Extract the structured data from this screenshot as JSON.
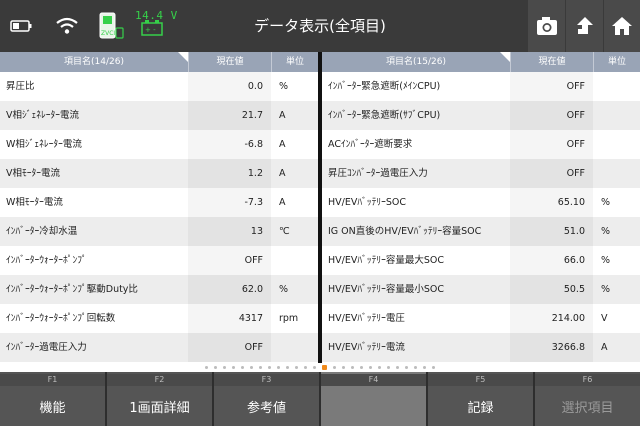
{
  "header": {
    "title": "データ表示(全項目)",
    "voltage": "14.4 V",
    "icons": [
      "battery-icon",
      "wifi-icon",
      "vci-icon",
      "car-battery-icon",
      "camera-icon",
      "upload-icon",
      "home-icon"
    ],
    "vci_label": "ZVCI"
  },
  "left_table": {
    "headers": {
      "name": "項目名(14/26)",
      "value": "現在値",
      "unit": "単位"
    },
    "rows": [
      {
        "name": "昇圧比",
        "value": "0.0",
        "unit": "%"
      },
      {
        "name": "V相ｼﾞｪﾈﾚｰﾀｰ電流",
        "value": "21.7",
        "unit": "A"
      },
      {
        "name": "W相ｼﾞｪﾈﾚｰﾀｰ電流",
        "value": "-6.8",
        "unit": "A"
      },
      {
        "name": "V相ﾓｰﾀｰ電流",
        "value": "1.2",
        "unit": "A"
      },
      {
        "name": "W相ﾓｰﾀｰ電流",
        "value": "-7.3",
        "unit": "A"
      },
      {
        "name": "ｲﾝﾊﾞｰﾀｰ冷却水温",
        "value": "13",
        "unit": "℃"
      },
      {
        "name": "ｲﾝﾊﾞｰﾀｰｳｫｰﾀｰﾎﾟﾝﾌﾟ",
        "value": "OFF",
        "unit": ""
      },
      {
        "name": "ｲﾝﾊﾞｰﾀｰｳｫｰﾀｰﾎﾟﾝﾌﾟ駆動Duty比",
        "value": "62.0",
        "unit": "%"
      },
      {
        "name": "ｲﾝﾊﾞｰﾀｰｳｫｰﾀｰﾎﾟﾝﾌﾟ回転数",
        "value": "4317",
        "unit": "rpm"
      },
      {
        "name": "ｲﾝﾊﾞｰﾀｰ過電圧入力",
        "value": "OFF",
        "unit": ""
      }
    ]
  },
  "right_table": {
    "headers": {
      "name": "項目名(15/26)",
      "value": "現在値",
      "unit": "単位"
    },
    "rows": [
      {
        "name": "ｲﾝﾊﾞｰﾀｰ緊急遮断(ﾒｲﾝCPU)",
        "value": "OFF",
        "unit": ""
      },
      {
        "name": "ｲﾝﾊﾞｰﾀｰ緊急遮断(ｻﾌﾞCPU)",
        "value": "OFF",
        "unit": ""
      },
      {
        "name": "ACｲﾝﾊﾞｰﾀｰ遮断要求",
        "value": "OFF",
        "unit": ""
      },
      {
        "name": "昇圧ｺﾝﾊﾞｰﾀｰ過電圧入力",
        "value": "OFF",
        "unit": ""
      },
      {
        "name": "HV/EVﾊﾞｯﾃﾘｰSOC",
        "value": "65.10",
        "unit": "%"
      },
      {
        "name": "IG ON直後のHV/EVﾊﾞｯﾃﾘｰ容量SOC",
        "value": "51.0",
        "unit": "%"
      },
      {
        "name": "HV/EVﾊﾞｯﾃﾘｰ容量最大SOC",
        "value": "66.0",
        "unit": "%"
      },
      {
        "name": "HV/EVﾊﾞｯﾃﾘｰ容量最小SOC",
        "value": "50.5",
        "unit": "%"
      },
      {
        "name": "HV/EVﾊﾞｯﾃﾘｰ電圧",
        "value": "214.00",
        "unit": "V"
      },
      {
        "name": "HV/EVﾊﾞｯﾃﾘｰ電流",
        "value": "3266.8",
        "unit": "A"
      }
    ]
  },
  "pager": {
    "total": 26,
    "active_index": 13
  },
  "footer": {
    "keys": [
      {
        "fn": "F1",
        "label": "機能",
        "state": "enabled"
      },
      {
        "fn": "F2",
        "label": "1画面詳細",
        "state": "enabled"
      },
      {
        "fn": "F3",
        "label": "参考値",
        "state": "enabled"
      },
      {
        "fn": "F4",
        "label": "",
        "state": "empty"
      },
      {
        "fn": "F5",
        "label": "記録",
        "state": "enabled"
      },
      {
        "fn": "F6",
        "label": "選択項目",
        "state": "disabled"
      }
    ]
  },
  "colors": {
    "accent": "#f08a1c",
    "voltage_green": "#36d04a",
    "header_bg": "#3a3a3a",
    "table_header": "#99a4b6"
  }
}
